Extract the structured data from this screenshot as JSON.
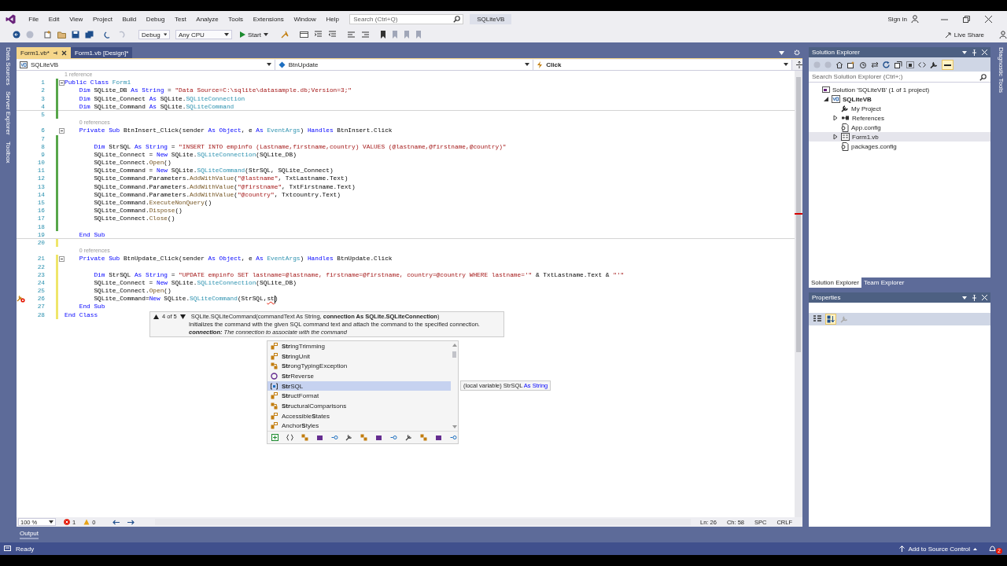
{
  "title_bar": {
    "menu": [
      "File",
      "Edit",
      "View",
      "Project",
      "Build",
      "Debug",
      "Test",
      "Analyze",
      "Tools",
      "Extensions",
      "Window",
      "Help"
    ],
    "search": {
      "placeholder": "Search (Ctrl+Q)"
    },
    "solution_name": "SQLiteVB",
    "sign_in": "Sign in"
  },
  "toolbar": {
    "configuration": "Debug",
    "platform": "Any CPU",
    "start": "Start",
    "live_share": "Live Share"
  },
  "left_tool_tabs": [
    "Data Sources",
    "Server Explorer",
    "Toolbox"
  ],
  "right_tool_tabs": [
    "Diagnostic Tools"
  ],
  "document_tabs": [
    {
      "label": "Form1.vb*",
      "selected": true
    },
    {
      "label": "Form1.vb [Design]*",
      "selected": false
    }
  ],
  "navigation_bar": {
    "project": "SQLiteVB",
    "object": "BtnUpdate",
    "event": "Click"
  },
  "editor": {
    "rows": [
      {
        "kind": "codelens",
        "text": "1 reference"
      },
      {
        "kind": "code",
        "number": "1",
        "color": "#57a64a",
        "tokens": [
          {
            "text": "Public Class ",
            "kind": "kw"
          },
          {
            "text": "Form1",
            "kind": "type"
          }
        ]
      },
      {
        "kind": "code",
        "number": "2",
        "color": "#57a64a",
        "tokens": [
          {
            "text": "    Dim ",
            "kind": "kw"
          },
          {
            "text": "SQLite_DB ",
            "kind": "plain"
          },
          {
            "text": "As String",
            "kind": "kw"
          },
          {
            "text": " = ",
            "kind": "plain"
          },
          {
            "text": "\"Data Source=C:\\sqlite\\datasample.db;Version=3;\"",
            "kind": "str"
          }
        ]
      },
      {
        "kind": "code",
        "number": "3",
        "color": "#57a64a",
        "tokens": [
          {
            "text": "    Dim ",
            "kind": "kw"
          },
          {
            "text": "SQLite_Connect ",
            "kind": "plain"
          },
          {
            "text": "As ",
            "kind": "kw"
          },
          {
            "text": "SQLite.",
            "kind": "plain"
          },
          {
            "text": "SQLiteConnection",
            "kind": "type"
          }
        ]
      },
      {
        "kind": "code",
        "number": "4",
        "color": "#57a64a",
        "tokens": [
          {
            "text": "    Dim ",
            "kind": "kw"
          },
          {
            "text": "SQLite_Command ",
            "kind": "plain"
          },
          {
            "text": "As ",
            "kind": "kw"
          },
          {
            "text": "SQLite.",
            "kind": "plain"
          },
          {
            "text": "SQLiteCommand",
            "kind": "type"
          }
        ]
      },
      {
        "kind": "code",
        "number": "5",
        "color": "#57a64a"
      },
      {
        "kind": "codelens",
        "text": "0 references"
      },
      {
        "kind": "code",
        "number": "6",
        "tokens": [
          {
            "text": "    Private Sub ",
            "kind": "kw"
          },
          {
            "text": "BtnInsert_Click(sender ",
            "kind": "plain"
          },
          {
            "text": "As Object",
            "kind": "kw"
          },
          {
            "text": ", e ",
            "kind": "plain"
          },
          {
            "text": "As ",
            "kind": "kw"
          },
          {
            "text": "EventArgs",
            "kind": "type"
          },
          {
            "text": ") ",
            "kind": "plain"
          },
          {
            "text": "Handles ",
            "kind": "kw"
          },
          {
            "text": "BtnInsert.Click",
            "kind": "plain"
          }
        ]
      },
      {
        "kind": "code",
        "number": "7",
        "color": "#57a64a"
      },
      {
        "kind": "code",
        "number": "8",
        "color": "#57a64a",
        "tokens": [
          {
            "text": "        Dim ",
            "kind": "kw"
          },
          {
            "text": "StrSQL ",
            "kind": "plain"
          },
          {
            "text": "As String",
            "kind": "kw"
          },
          {
            "text": " = ",
            "kind": "plain"
          },
          {
            "text": "\"INSERT INTO empinfo (Lastname,firstname,country) VALUES (@lastname,@firstname,@country)\"",
            "kind": "str"
          }
        ]
      },
      {
        "kind": "code",
        "number": "9",
        "color": "#57a64a",
        "tokens": [
          {
            "text": "        SQLite_Connect = ",
            "kind": "plain"
          },
          {
            "text": "New ",
            "kind": "kw"
          },
          {
            "text": "SQLite.",
            "kind": "plain"
          },
          {
            "text": "SQLiteConnection",
            "kind": "type"
          },
          {
            "text": "(SQLite_DB)",
            "kind": "plain"
          }
        ]
      },
      {
        "kind": "code",
        "number": "10",
        "color": "#57a64a",
        "tokens": [
          {
            "text": "        SQLite_Connect.",
            "kind": "plain"
          },
          {
            "text": "Open",
            "kind": "method"
          },
          {
            "text": "()",
            "kind": "plain"
          }
        ]
      },
      {
        "kind": "code",
        "number": "11",
        "color": "#57a64a",
        "tokens": [
          {
            "text": "        SQLite_Command = ",
            "kind": "plain"
          },
          {
            "text": "New ",
            "kind": "kw"
          },
          {
            "text": "SQLite.",
            "kind": "plain"
          },
          {
            "text": "SQLiteCommand",
            "kind": "type"
          },
          {
            "text": "(StrSQL, SQLite_Connect)",
            "kind": "plain"
          }
        ]
      },
      {
        "kind": "code",
        "number": "12",
        "color": "#57a64a",
        "tokens": [
          {
            "text": "        SQLite_Command.Parameters.",
            "kind": "plain"
          },
          {
            "text": "AddWithValue",
            "kind": "method"
          },
          {
            "text": "(",
            "kind": "plain"
          },
          {
            "text": "\"@lastname\"",
            "kind": "str"
          },
          {
            "text": ", TxtLastname.Text)",
            "kind": "plain"
          }
        ]
      },
      {
        "kind": "code",
        "number": "13",
        "color": "#57a64a",
        "tokens": [
          {
            "text": "        SQLite_Command.Parameters.",
            "kind": "plain"
          },
          {
            "text": "AddWithValue",
            "kind": "method"
          },
          {
            "text": "(",
            "kind": "plain"
          },
          {
            "text": "\"@firstname\"",
            "kind": "str"
          },
          {
            "text": ", TxtFirstname.Text)",
            "kind": "plain"
          }
        ]
      },
      {
        "kind": "code",
        "number": "14",
        "color": "#57a64a",
        "tokens": [
          {
            "text": "        SQLite_Command.Parameters.",
            "kind": "plain"
          },
          {
            "text": "AddWithValue",
            "kind": "method"
          },
          {
            "text": "(",
            "kind": "plain"
          },
          {
            "text": "\"@country\"",
            "kind": "str"
          },
          {
            "text": ", Txtcountry.Text)",
            "kind": "plain"
          }
        ]
      },
      {
        "kind": "code",
        "number": "15",
        "color": "#57a64a",
        "tokens": [
          {
            "text": "        SQLite_Command.",
            "kind": "plain"
          },
          {
            "text": "ExecuteNonQuery",
            "kind": "method"
          },
          {
            "text": "()",
            "kind": "plain"
          }
        ]
      },
      {
        "kind": "code",
        "number": "16",
        "color": "#57a64a",
        "tokens": [
          {
            "text": "        SQLite_Command.",
            "kind": "plain"
          },
          {
            "text": "Dispose",
            "kind": "method"
          },
          {
            "text": "()",
            "kind": "plain"
          }
        ]
      },
      {
        "kind": "code",
        "number": "17",
        "color": "#57a64a",
        "tokens": [
          {
            "text": "        SQLite_Connect.",
            "kind": "plain"
          },
          {
            "text": "Close",
            "kind": "method"
          },
          {
            "text": "()",
            "kind": "plain"
          }
        ]
      },
      {
        "kind": "code",
        "number": "18",
        "color": "#57a64a"
      },
      {
        "kind": "code",
        "number": "19",
        "tokens": [
          {
            "text": "    End Sub",
            "kind": "kw"
          }
        ]
      },
      {
        "kind": "code",
        "number": "20",
        "color": "#efe66a"
      },
      {
        "kind": "codelens",
        "text": "0 references"
      },
      {
        "kind": "code",
        "number": "21",
        "color": "#efe66a",
        "tokens": [
          {
            "text": "    Private Sub ",
            "kind": "kw"
          },
          {
            "text": "BtnUpdate_Click(sender ",
            "kind": "plain"
          },
          {
            "text": "As Object",
            "kind": "kw"
          },
          {
            "text": ", e ",
            "kind": "plain"
          },
          {
            "text": "As ",
            "kind": "kw"
          },
          {
            "text": "EventArgs",
            "kind": "type"
          },
          {
            "text": ") ",
            "kind": "plain"
          },
          {
            "text": "Handles ",
            "kind": "kw"
          },
          {
            "text": "BtnUpdate.Click",
            "kind": "plain"
          }
        ]
      },
      {
        "kind": "code",
        "number": "22",
        "color": "#efe66a"
      },
      {
        "kind": "code",
        "number": "23",
        "color": "#efe66a",
        "tokens": [
          {
            "text": "        Dim ",
            "kind": "kw"
          },
          {
            "text": "StrSQL ",
            "kind": "plain"
          },
          {
            "text": "As String",
            "kind": "kw"
          },
          {
            "text": " = ",
            "kind": "plain"
          },
          {
            "text": "\"UPDATE empinfo SET lastname=@lastname, firstname=@firstname, country=@country WHERE lastname='\"",
            "kind": "str"
          },
          {
            "text": " & TxtLastname.Text & ",
            "kind": "plain"
          },
          {
            "text": "\"'\"",
            "kind": "str"
          }
        ]
      },
      {
        "kind": "code",
        "number": "24",
        "color": "#efe66a",
        "tokens": [
          {
            "text": "        SQLite_Connect = ",
            "kind": "plain"
          },
          {
            "text": "New ",
            "kind": "kw"
          },
          {
            "text": "SQLite.",
            "kind": "plain"
          },
          {
            "text": "SQLiteConnection",
            "kind": "type"
          },
          {
            "text": "(SQLite_DB)",
            "kind": "plain"
          }
        ]
      },
      {
        "kind": "code",
        "number": "25",
        "color": "#efe66a",
        "tokens": [
          {
            "text": "        SQLite_Connect.",
            "kind": "plain"
          },
          {
            "text": "Open",
            "kind": "method"
          },
          {
            "text": "()",
            "kind": "plain"
          }
        ]
      },
      {
        "kind": "code",
        "number": "26",
        "color": "#efe66a",
        "tokens": [
          {
            "text": "        SQLite_Command=",
            "kind": "plain"
          },
          {
            "text": "New ",
            "kind": "kw"
          },
          {
            "text": "SQLite.",
            "kind": "plain"
          },
          {
            "text": "SQLiteCommand",
            "kind": "type"
          },
          {
            "text": "(StrSQL,",
            "kind": "plain"
          },
          {
            "text": "st",
            "kind": "error"
          },
          {
            "text": ")",
            "kind": "plain"
          }
        ]
      },
      {
        "kind": "code",
        "number": "27",
        "color": "#efe66a",
        "tokens": [
          {
            "text": "    End Sub",
            "kind": "kw"
          }
        ]
      },
      {
        "kind": "code",
        "number": "28",
        "color": "#efe66a",
        "tokens": [
          {
            "text": "End Class",
            "kind": "kw"
          }
        ]
      }
    ],
    "signature_help": {
      "counter": "4 of 5",
      "signature": "SQLite.SQLiteCommand(commandText As String, **connection As SQLite.SQLiteConnection**)",
      "description": "Initializes the command with the given SQL command text and attach the command to the specified connection.",
      "parameter": "**connection:** The connection to associate with the command"
    },
    "completion": {
      "items": [
        {
          "label": "**Str**ingTrimming",
          "kind": "enum",
          "selected": false
        },
        {
          "label": "**Str**ingUnit",
          "kind": "enum",
          "selected": false
        },
        {
          "label": "**Str**ongTypingException",
          "kind": "class",
          "selected": false
        },
        {
          "label": "**Str**Reverse",
          "kind": "method",
          "selected": false
        },
        {
          "label": "**Str**SQL",
          "kind": "local",
          "selected": true
        },
        {
          "label": "**Str**uctFormat",
          "kind": "enum",
          "selected": false
        },
        {
          "label": "**Str**ucturalComparisons",
          "kind": "class",
          "selected": false
        },
        {
          "label": "Accessible**S**tates",
          "kind": "enum",
          "selected": false
        },
        {
          "label": "Anchor**S**tyles",
          "kind": "enum",
          "selected": false
        }
      ],
      "quick_info": {
        "text": "(local variable) StrSQL",
        "type": "As String"
      }
    },
    "status": {
      "zoom": "100 %",
      "errors": "1",
      "warnings": "0",
      "line": "Ln: 26",
      "column": "Ch: 58",
      "whitespace": "SPC",
      "line_ending": "CRLF"
    }
  },
  "solution_explorer": {
    "title": "Solution Explorer",
    "search": {
      "placeholder": "Search Solution Explorer (Ctrl+;)"
    },
    "tree": [
      {
        "label": "Solution 'SQLiteVB' (1 of 1 project)",
        "kind": "solution",
        "selected": false,
        "children": [
          {
            "label": "SQLiteVB",
            "kind": "project",
            "selected": false,
            "expanded": true,
            "children": [
              {
                "label": "My Project",
                "kind": "properties",
                "selected": false
              },
              {
                "label": "References",
                "kind": "references",
                "selected": false,
                "expanded": false
              },
              {
                "label": "App.config",
                "kind": "config",
                "selected": false
              },
              {
                "label": "Form1.vb",
                "kind": "form",
                "selected": true,
                "expanded": false
              },
              {
                "label": "packages.config",
                "kind": "config",
                "selected": false
              }
            ]
          }
        ]
      }
    ],
    "tabs": [
      {
        "label": "Solution Explorer",
        "selected": true
      },
      {
        "label": "Team Explorer",
        "selected": false
      }
    ]
  },
  "properties": {
    "title": "Properties"
  },
  "output_tab": "Output",
  "status_bar": {
    "message": "Ready",
    "source_control": "Add to Source Control",
    "notifications": "2"
  }
}
